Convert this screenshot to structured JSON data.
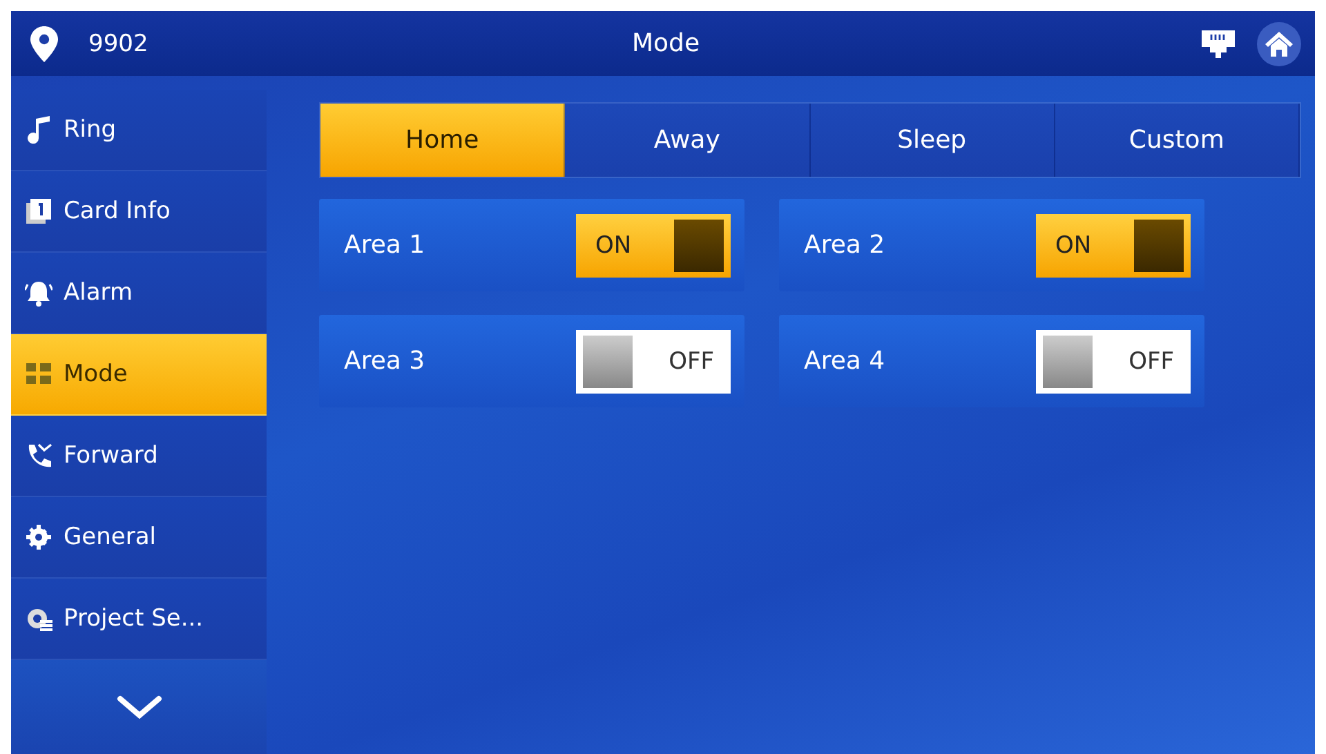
{
  "header": {
    "location": "9902",
    "title": "Mode"
  },
  "sidebar": {
    "items": [
      {
        "label": "Ring",
        "selected": false
      },
      {
        "label": "Card Info",
        "selected": false
      },
      {
        "label": "Alarm",
        "selected": false
      },
      {
        "label": "Mode",
        "selected": true
      },
      {
        "label": "Forward",
        "selected": false
      },
      {
        "label": "General",
        "selected": false
      },
      {
        "label": "Project Se...",
        "selected": false
      }
    ]
  },
  "tabs": [
    {
      "label": "Home",
      "selected": true
    },
    {
      "label": "Away",
      "selected": false
    },
    {
      "label": "Sleep",
      "selected": false
    },
    {
      "label": "Custom",
      "selected": false
    }
  ],
  "areas": [
    {
      "label": "Area 1",
      "on": true,
      "switch_text": "ON"
    },
    {
      "label": "Area 2",
      "on": true,
      "switch_text": "ON"
    },
    {
      "label": "Area 3",
      "on": false,
      "switch_text": "OFF"
    },
    {
      "label": "Area 4",
      "on": false,
      "switch_text": "OFF"
    }
  ]
}
